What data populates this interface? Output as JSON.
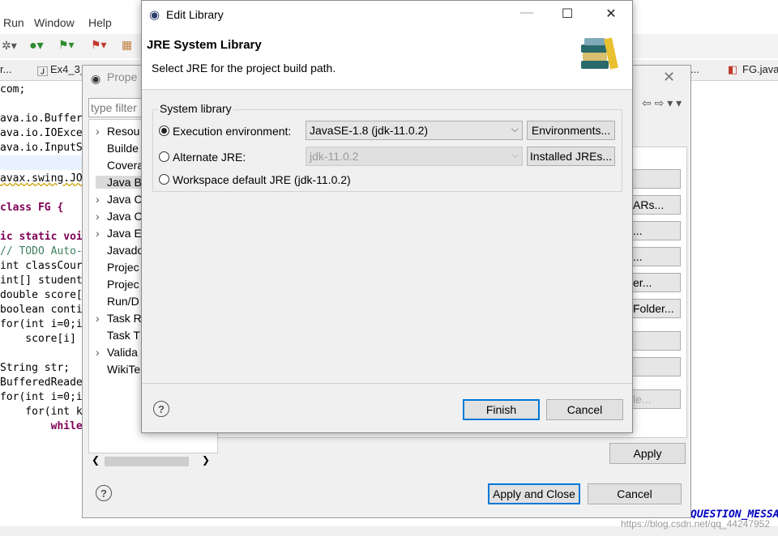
{
  "menubar": {
    "items": [
      "Run",
      "Window",
      "Help"
    ]
  },
  "editor_tabs": {
    "left": "r...",
    "ex4": "Ex4_3_",
    "right": "FG.java"
  },
  "code": {
    "lines": [
      {
        "t": "com;"
      },
      {
        "t": ""
      },
      {
        "t": "ava.io.Buffer"
      },
      {
        "t": "ava.io.IOExce"
      },
      {
        "t": "ava.io.InputS"
      },
      {
        "t": ""
      },
      {
        "t": "avax.swing.JO"
      },
      {
        "t": ""
      },
      {
        "t": "class FG {"
      },
      {
        "t": ""
      },
      {
        "t": "ic static voi"
      },
      {
        "t": "// TODO Auto-"
      },
      {
        "t": "int classCour"
      },
      {
        "t": "int[] student"
      },
      {
        "t": "double score["
      },
      {
        "t": "boolean conti"
      },
      {
        "t": "for(int i=0;i"
      },
      {
        "t": "    score[i]"
      },
      {
        "t": ""
      },
      {
        "t": "String str;"
      },
      {
        "t": "BufferedReade"
      },
      {
        "t": "for(int i=0;i"
      },
      {
        "t": "    for(int k"
      },
      {
        "t": "        while"
      }
    ],
    "bottom_fragment": "QUESTION_MESSA"
  },
  "properties_dialog": {
    "title": "Prope",
    "filter_placeholder": "type filter",
    "tree": [
      {
        "label": "Resou",
        "chev": true
      },
      {
        "label": "Builde",
        "chev": false
      },
      {
        "label": "Covera",
        "chev": false
      },
      {
        "label": "Java Bu",
        "chev": false,
        "selected": true
      },
      {
        "label": "Java Co",
        "chev": true
      },
      {
        "label": "Java Co",
        "chev": true
      },
      {
        "label": "Java Ed",
        "chev": true
      },
      {
        "label": "Javado",
        "chev": false
      },
      {
        "label": "Projec",
        "chev": false
      },
      {
        "label": "Projec",
        "chev": false
      },
      {
        "label": "Run/D",
        "chev": false
      },
      {
        "label": "Task R",
        "chev": true
      },
      {
        "label": "Task T",
        "chev": false
      },
      {
        "label": "Valida",
        "chev": true
      },
      {
        "label": "WikiTe",
        "chev": false
      }
    ],
    "side_buttons": [
      "",
      "ARs...",
      "...",
      "...",
      "er...",
      "Folder...",
      "",
      "",
      "le..."
    ],
    "apply_label": "Apply",
    "apply_close_label": "Apply and Close",
    "cancel_label": "Cancel"
  },
  "edit_library": {
    "window_title": "Edit Library",
    "header_title": "JRE System Library",
    "header_desc": "Select JRE for the project build path.",
    "group_label": "System library",
    "exec_env_label": "Execution environment:",
    "exec_env_value": "JavaSE-1.8 (jdk-11.0.2)",
    "environments_button": "Environments...",
    "alt_jre_label": "Alternate JRE:",
    "alt_jre_value": "jdk-11.0.2",
    "installed_jres_button": "Installed JREs...",
    "workspace_label": "Workspace default JRE (jdk-11.0.2)",
    "finish_label": "Finish",
    "cancel_label": "Cancel",
    "selected_option": "execution-environment"
  },
  "watermark": "https://blog.csdn.net/qq_44247952",
  "colors": {
    "accent": "#0078d7",
    "keyword": "#7f0055",
    "comment": "#3f7f5f"
  }
}
